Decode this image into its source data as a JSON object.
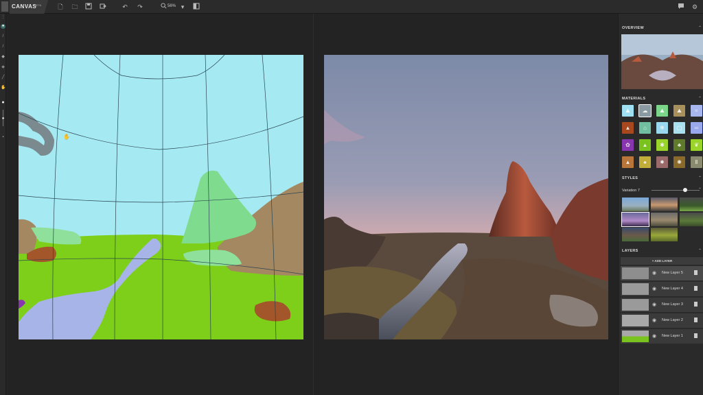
{
  "app": {
    "title": "CANVAS",
    "badge": "BETA"
  },
  "toolbar": {
    "zoom": "56%"
  },
  "sidebar": {
    "overview_title": "OVERVIEW",
    "materials_title": "MATERIALS",
    "styles_title": "STYLES",
    "style_variation": "Variation 7",
    "style_slider_value": 0.8,
    "layers_title": "LAYERS",
    "add_layer_label": "+ ADD LAYER",
    "layers": [
      {
        "name": "New Layer 5"
      },
      {
        "name": "New Layer 4"
      },
      {
        "name": "New Layer 3"
      },
      {
        "name": "New Layer 2"
      },
      {
        "name": "New Layer 1"
      }
    ]
  },
  "materials": [
    {
      "name": "sky",
      "color": "#9fe0f2"
    },
    {
      "name": "cloud",
      "color": "#8a9aa3"
    },
    {
      "name": "grass-hill",
      "color": "#7bd68a"
    },
    {
      "name": "mountain",
      "color": "#a8905c"
    },
    {
      "name": "water",
      "color": "#a8b6f0"
    },
    {
      "name": "rock-dark",
      "color": "#a8481e"
    },
    {
      "name": "building",
      "color": "#6fbfa0"
    },
    {
      "name": "snow",
      "color": "#9ad8f0"
    },
    {
      "name": "ice",
      "color": "#a8e0f0"
    },
    {
      "name": "river",
      "color": "#9aa8ee"
    },
    {
      "name": "flower",
      "color": "#8a35b0"
    },
    {
      "name": "grass",
      "color": "#7ac21e"
    },
    {
      "name": "plant",
      "color": "#9ad42a"
    },
    {
      "name": "tree",
      "color": "#5f7a2a"
    },
    {
      "name": "bush",
      "color": "#9ad42a"
    },
    {
      "name": "dirt",
      "color": "#b8763a"
    },
    {
      "name": "palm",
      "color": "#c0ad3a"
    },
    {
      "name": "gravel",
      "color": "#9a6a6a"
    },
    {
      "name": "sand",
      "color": "#8a6a2a"
    },
    {
      "name": "fence",
      "color": "#8a8a70"
    }
  ]
}
